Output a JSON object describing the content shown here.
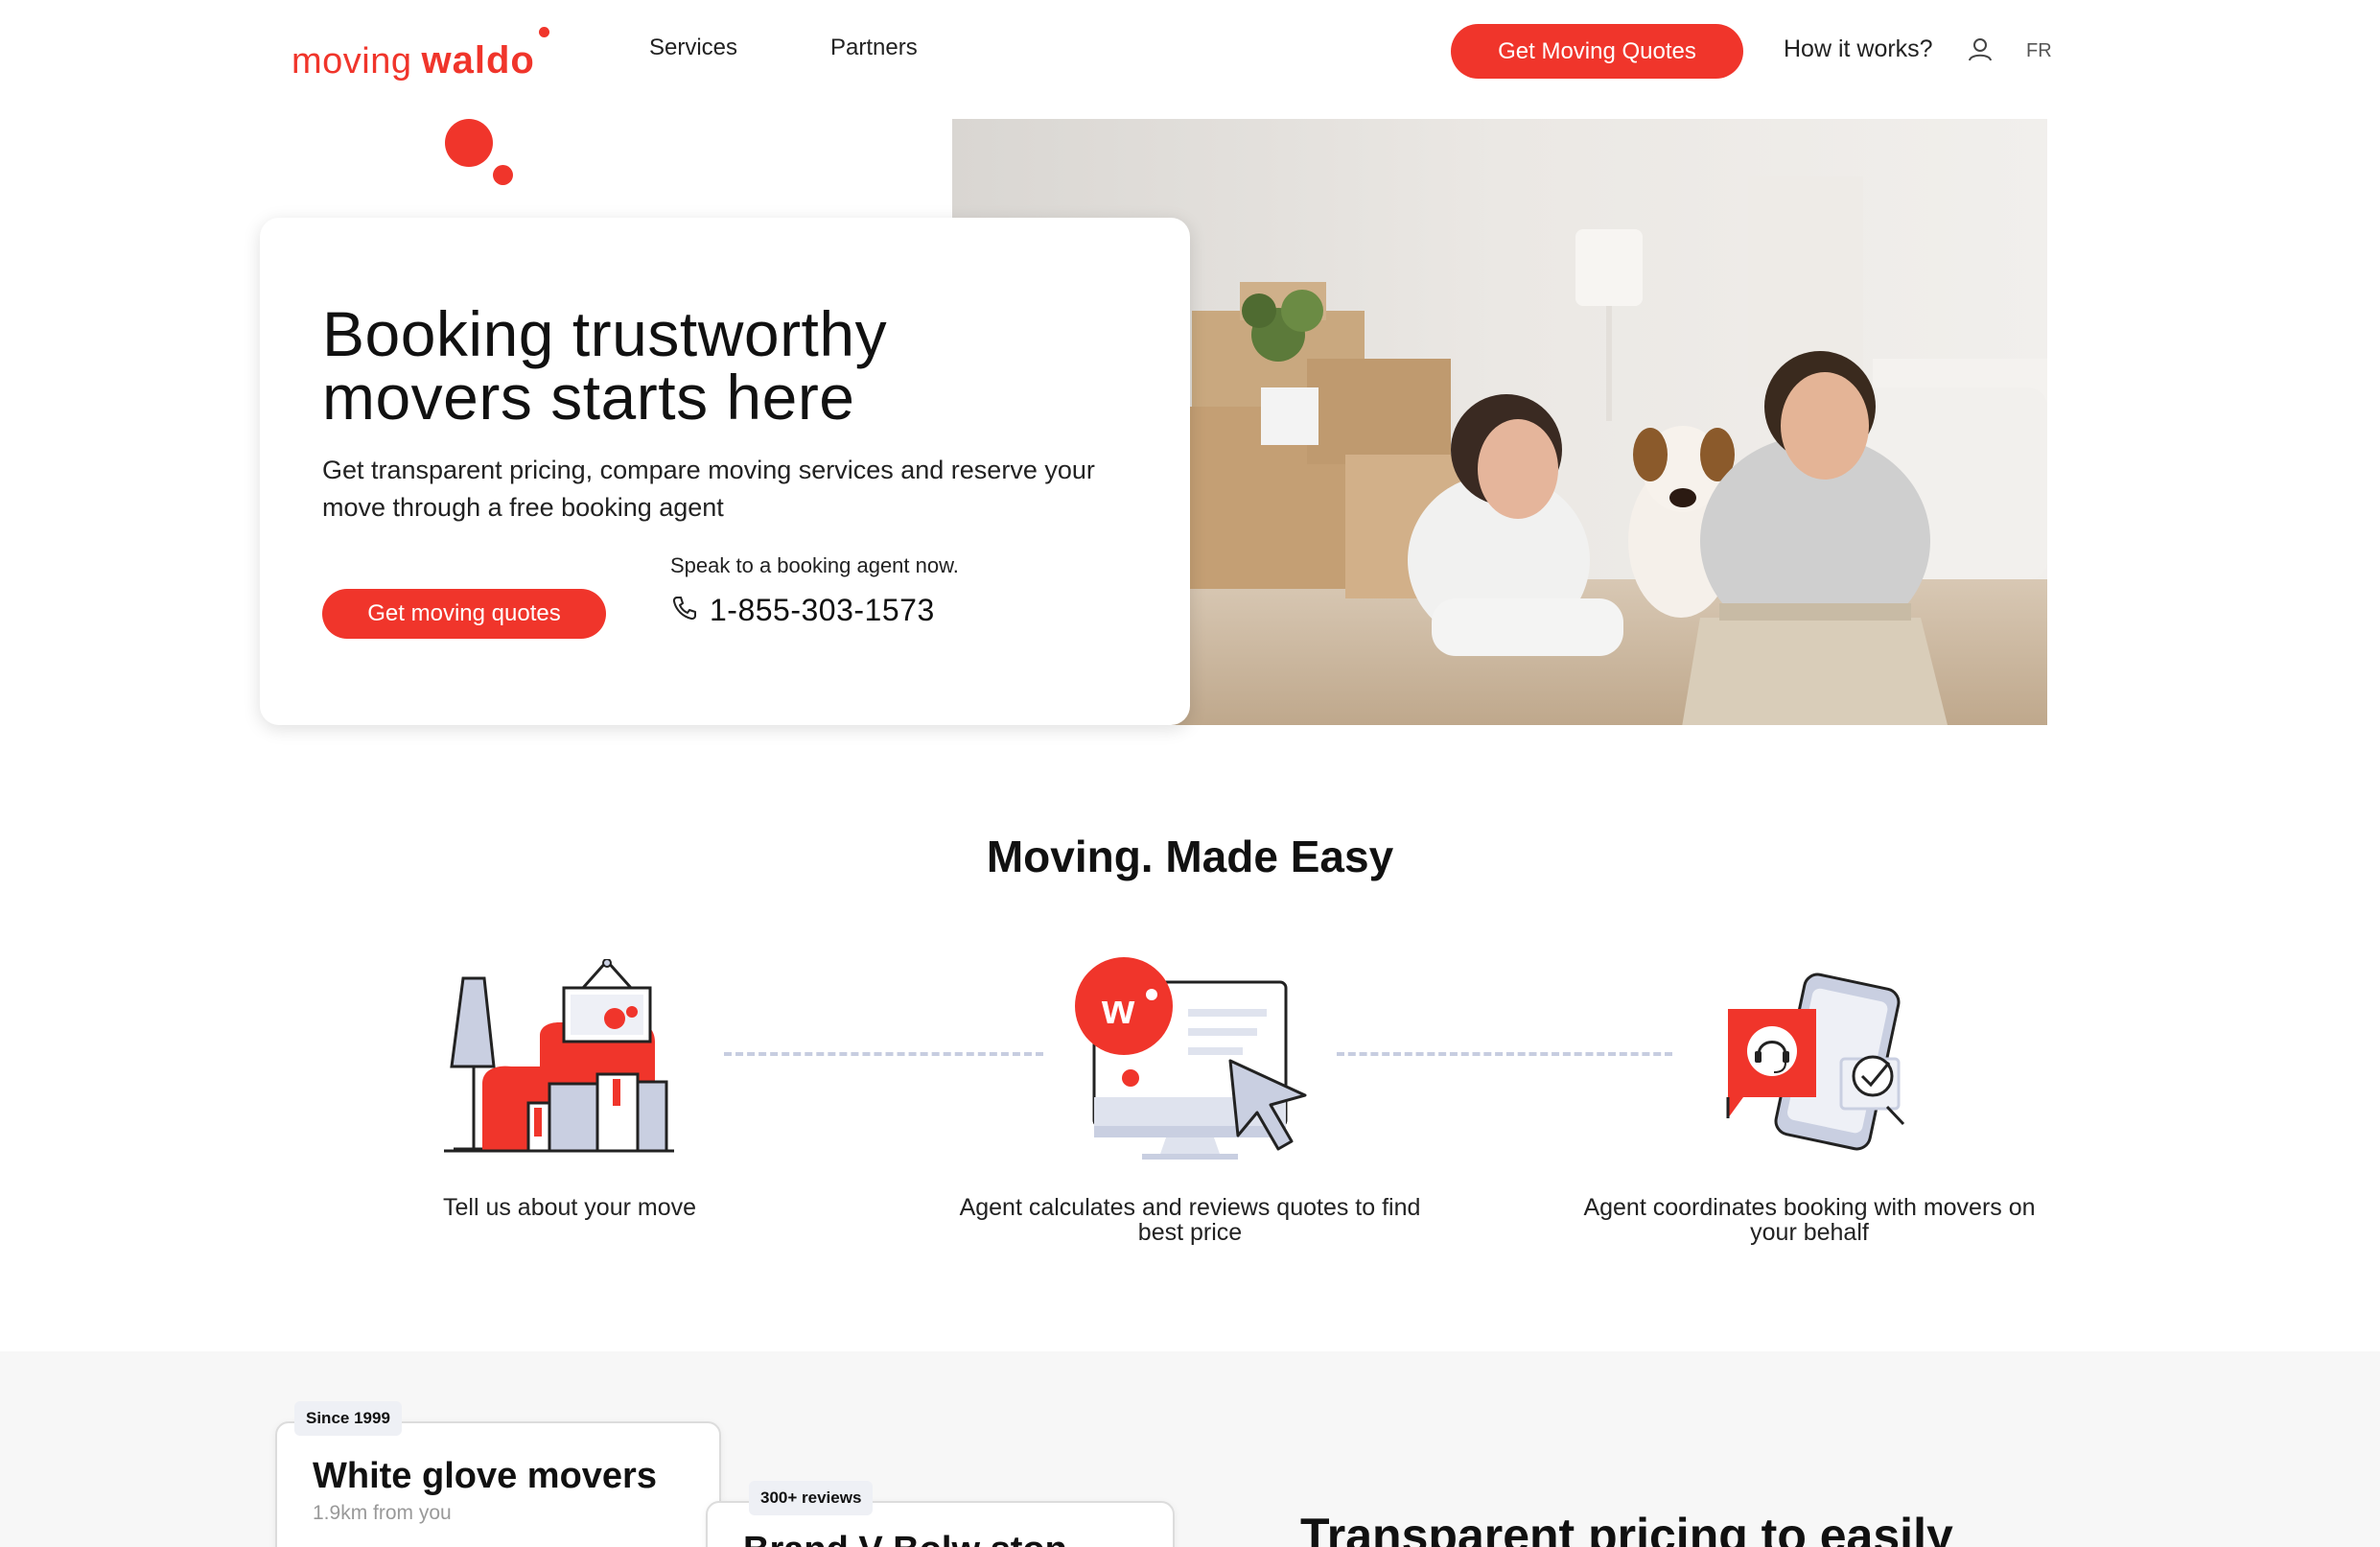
{
  "header": {
    "logo_word1": "moving",
    "logo_word2": "waldo",
    "nav": [
      "Services",
      "Partners"
    ],
    "cta_label": "Get Moving Quotes",
    "how_it_works": "How it works?",
    "user_icon": "user-icon",
    "language": "FR"
  },
  "hero": {
    "title": "Booking trustworthy movers starts here",
    "subtitle": "Get transparent pricing, compare moving services and reserve your move through a free booking agent",
    "cta_label": "Get moving quotes",
    "agent_text": "Speak to a booking agent now.",
    "phone_icon": "phone-icon",
    "phone": "1-855-303-1573"
  },
  "steps_section": {
    "title": "Moving. Made Easy",
    "steps": [
      {
        "label": "Tell us about your move",
        "icon": "house-illustration-icon"
      },
      {
        "label": "Agent calculates and reviews quotes to find best price",
        "icon": "computer-quote-icon"
      },
      {
        "label": "Agent coordinates booking with movers on your behalf",
        "icon": "agent-phone-icon"
      }
    ]
  },
  "movers_preview": {
    "cards": [
      {
        "badge": "Since 1999",
        "name": "White glove movers",
        "distance": "1.9km from you"
      },
      {
        "badge": "300+ reviews",
        "name": "Brand V Bolw ston",
        "distance": ""
      }
    ],
    "pricing_title": "Transparent pricing to easily"
  },
  "colors": {
    "brand_red": "#f0352b",
    "dash_gray": "#c7cde0",
    "illustration_blue": "#c9cfe1"
  }
}
